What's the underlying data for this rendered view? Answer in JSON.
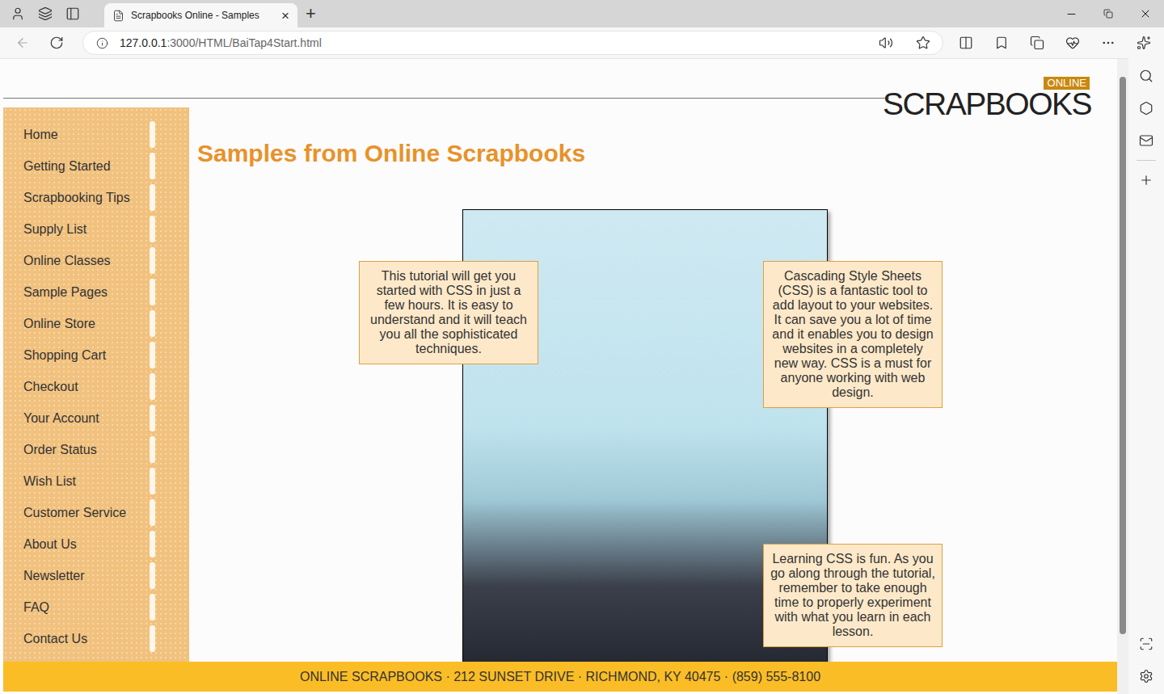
{
  "browser": {
    "tab": {
      "title": "Scrapbooks Online - Samples",
      "close": "×"
    },
    "new_tab": "+",
    "address": {
      "host": "127.0.0.1",
      "path": ":3000/HTML/BaiTap4Start.html"
    }
  },
  "page": {
    "logo": {
      "badge": "ONLINE",
      "name": "SCRAPBOOKS"
    },
    "nav": [
      "Home",
      "Getting Started",
      "Scrapbooking Tips",
      "Supply List",
      "Online Classes",
      "Sample Pages",
      "Online Store",
      "Shopping Cart",
      "Checkout",
      "Your Account",
      "Order Status",
      "Wish List",
      "Customer Service",
      "About Us",
      "Newsletter",
      "FAQ",
      "Contact Us"
    ],
    "heading": "Samples from Online Scrapbooks",
    "notes": [
      "This tutorial will get you started with CSS in just a few hours. It is easy to understand and it will teach you all the sophisticated techniques.",
      "Cascading Style Sheets (CSS) is a fantastic tool to add layout to your websites. It can save you a lot of time and it enables you to design websites in a completely new way. CSS is a must for anyone working with web design.",
      "Learning CSS is fun. As you go along through the tutorial, remember to take enough time to properly experiment with what you learn in each lesson."
    ],
    "footer": "ONLINE SCRAPBOOKS · 212 SUNSET DRIVE · RICHMOND, KY 40475 · (859) 555-8100"
  }
}
